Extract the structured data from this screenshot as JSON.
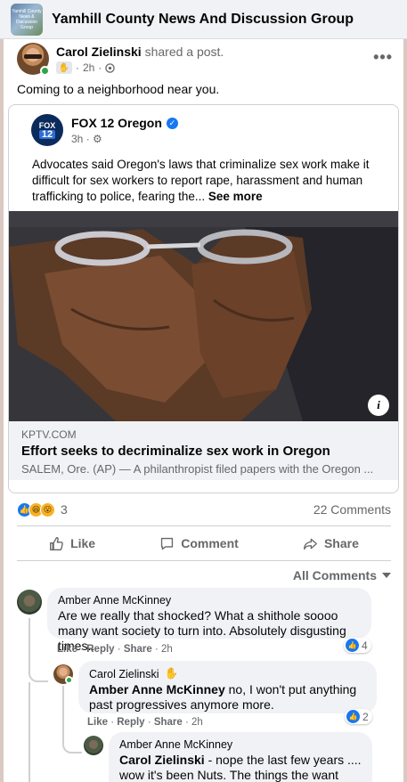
{
  "group": {
    "name": "Yamhill County News And Discussion Group",
    "thumb_text": "Yamhill County News & Discussion Group"
  },
  "post": {
    "author": "Carol Zielinski",
    "action": "shared a post.",
    "time": "2h",
    "text": "Coming to a neighborhood near you.",
    "more_icon": "more-horizontal-icon"
  },
  "shared": {
    "page_name": "FOX 12 Oregon",
    "time": "3h",
    "logo_top": "FOX",
    "logo_bottom": "12",
    "text": "Advocates said Oregon's laws that criminalize sex work make it difficult for sex workers to report rape, harassment and human trafficking to police, fearing the...",
    "see_more": "See more",
    "link_domain": "KPTV.COM",
    "link_title": "Effort seeks to decriminalize sex work in Oregon",
    "link_desc": "SALEM, Ore. (AP) — A philanthropist filed papers with the Oregon ..."
  },
  "stats": {
    "reactions_count": "3",
    "comments_label": "22 Comments"
  },
  "actions": {
    "like": "Like",
    "comment": "Comment",
    "share": "Share"
  },
  "comments_filter": "All Comments",
  "comments": [
    {
      "author": "Amber Anne McKinney",
      "text": "Are we really that shocked? What a shithole soooo many want society to turn into. Absolutely disgusting times..",
      "actions": {
        "like": "Like",
        "reply": "Reply",
        "share": "Share",
        "time": "2h"
      },
      "reactions": "4"
    },
    {
      "author": "Carol Zielinski",
      "mention": "Amber Anne McKinney",
      "text": " no, I won't put anything past progressives anymore more.",
      "actions": {
        "like": "Like",
        "reply": "Reply",
        "share": "Share",
        "time": "2h"
      },
      "reactions": "2"
    },
    {
      "author": "Amber Anne McKinney",
      "mention": "Carol Zielinski",
      "text_line1": " - nope the last few years ....",
      "text_line2": "wow it's been Nuts. The things the want OUR"
    }
  ],
  "colors": {
    "accent": "#1877f2",
    "muted": "#65676b",
    "online": "#31a24c"
  }
}
